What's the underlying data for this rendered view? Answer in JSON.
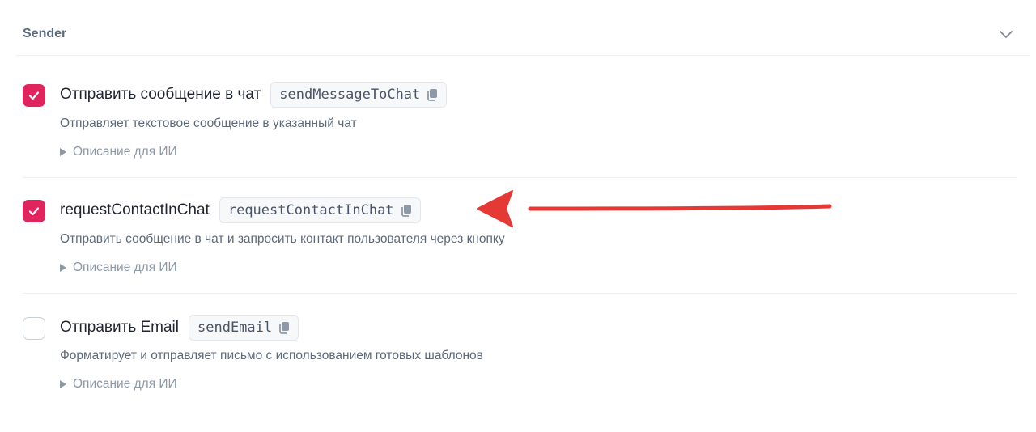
{
  "section": {
    "title": "Sender"
  },
  "items": [
    {
      "title": "Отправить сообщение в чат",
      "code": "sendMessageToChat",
      "description": "Отправляет текстовое сообщение в указанный чат",
      "ai_label": "Описание для ИИ",
      "checked": true
    },
    {
      "title": "requestContactInChat",
      "code": "requestContactInChat",
      "description": "Отправить сообщение в чат и запросить контакт пользователя через кнопку",
      "ai_label": "Описание для ИИ",
      "checked": true
    },
    {
      "title": "Отправить Email",
      "code": "sendEmail",
      "description": "Форматирует и отправляет письмо с использованием готовых шаблонов",
      "ai_label": "Описание для ИИ",
      "checked": false
    }
  ],
  "colors": {
    "checkbox_checked": "#e0245e",
    "annotation_arrow": "#e53935",
    "section_title": "#5b6b7f"
  },
  "icons": {
    "collapse": "chevron-down-icon",
    "copy": "copy-icon",
    "check": "checkmark-icon",
    "expand": "triangle-right-icon"
  }
}
